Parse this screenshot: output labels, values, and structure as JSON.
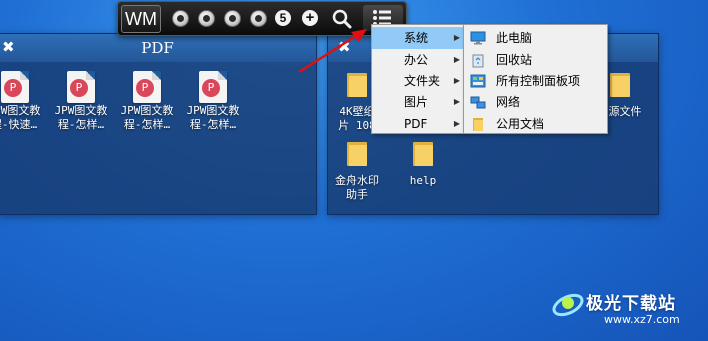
{
  "left_panel": {
    "title": "PDF",
    "close_glyph": "✖",
    "items": [
      {
        "label": "JPW图文教\n程-快速…",
        "icon": "pdf-file-icon"
      },
      {
        "label": "JPW图文教\n程-怎样…",
        "icon": "pdf-file-icon"
      },
      {
        "label": "JPW图文教\n程-怎样…",
        "icon": "pdf-file-icon"
      },
      {
        "label": "JPW图文教\n程-怎样…",
        "icon": "pdf-file-icon"
      }
    ]
  },
  "right_panel": {
    "close_glyph": "✖",
    "items": [
      {
        "label": "4K壁纸\n片 108",
        "icon": "folder-icon"
      },
      {
        "label": "源文件",
        "icon": "folder-icon"
      },
      {
        "label": "金舟水印\n助手",
        "icon": "folder-icon"
      },
      {
        "label": "help",
        "icon": "folder-icon"
      }
    ]
  },
  "toolbar": {
    "logo": "WM",
    "number_badge": "5",
    "plus_glyph": "+"
  },
  "menu": {
    "items": [
      {
        "label": "系统",
        "active": true
      },
      {
        "label": "办公",
        "active": false
      },
      {
        "label": "文件夹",
        "active": false
      },
      {
        "label": "图片",
        "active": false
      },
      {
        "label": "PDF",
        "active": false
      }
    ],
    "arrow_glyph": "▶"
  },
  "submenu": {
    "items": [
      {
        "label": "此电脑",
        "icon": "computer-icon"
      },
      {
        "label": "回收站",
        "icon": "recycle-bin-icon"
      },
      {
        "label": "所有控制面板项",
        "icon": "control-panel-icon"
      },
      {
        "label": "网络",
        "icon": "network-icon"
      },
      {
        "label": "公用文档",
        "icon": "folder-icon"
      }
    ]
  },
  "watermark": {
    "brand": "极光下载站",
    "url": "www.xz7.com"
  },
  "colors": {
    "desktop": "#1f6fd4",
    "panel": "#183a6e",
    "menu_active": "#91c9f7",
    "arrow": "#e01010",
    "pdf_badge": "#d9475a",
    "folder": "#f7d166"
  }
}
